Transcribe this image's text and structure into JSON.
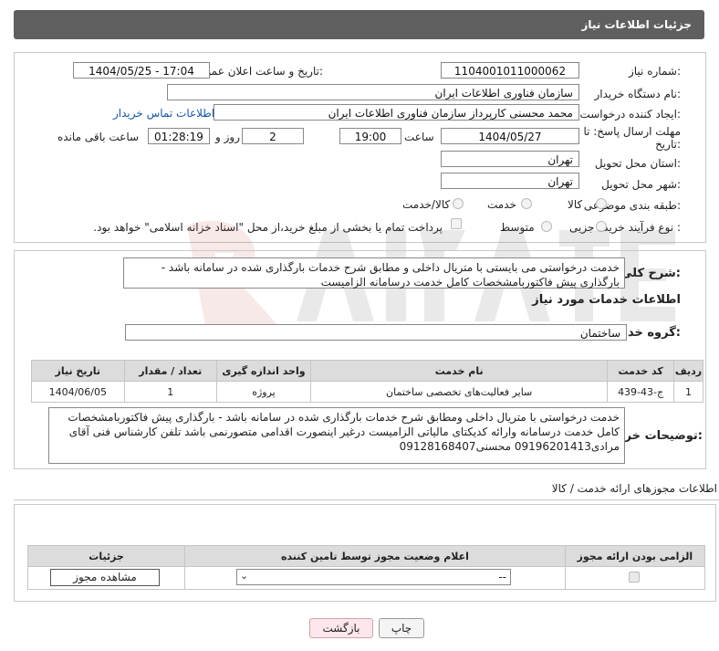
{
  "header": {
    "title": "جزئیات اطلاعات نیاز"
  },
  "form": {
    "need_number_label": "شماره نیاز:",
    "need_number": "1104001011000062",
    "announce_label": "تاریخ و ساعت اعلان عمومی:",
    "announce_value": "1404/05/25 - 17:04",
    "buyer_org_label": "نام دستگاه خریدار:",
    "buyer_org": "سازمان فناوری اطلاعات ایران",
    "requester_label": "ایجاد کننده درخواست:",
    "requester": "محمد محسنی کارپرداز سازمان فناوری اطلاعات ایران",
    "contact_link": "اطلاعات تماس خریدار",
    "deadline_label_1": "مهلت ارسال پاسخ: تا",
    "deadline_label_2": "تاریخ:",
    "deadline_date": "1404/05/27",
    "time_label": "ساعت",
    "deadline_time": "19:00",
    "days": "2",
    "days_label": "روز و",
    "remaining": "01:28:19",
    "remaining_label": "ساعت باقی مانده",
    "province_label": "استان محل تحویل:",
    "province": "تهران",
    "city_label": "شهر محل تحویل:",
    "city": "تهران",
    "category_label": "طبقه بندی موضوعی:",
    "category_options": [
      "کالا",
      "خدمت",
      "کالا/خدمت"
    ],
    "purchase_type_label": "نوع فرآیند خرید :",
    "purchase_type_options": [
      "جزیی",
      "متوسط"
    ],
    "treasury_note": "پرداخت تمام یا بخشی از مبلغ خرید،از محل \"اسناد خزانه اسلامی\" خواهد بود."
  },
  "summary": {
    "label": "شرح کلی نیاز:",
    "text": "خدمت درخواستی می بایستی با متریال داخلی و مطابق شرح خدمات بارگذاری شده در سامانه باشد - بارگذاری پیش فاکتوربامشخصات کامل خدمت درسامانه الزامیست"
  },
  "services": {
    "section_title": "اطلاعات خدمات مورد نیاز",
    "group_label": "گروه خدمت:",
    "group_value": "ساختمان",
    "columns": [
      "ردیف",
      "کد خدمت",
      "نام خدمت",
      "واحد اندازه گیری",
      "تعداد / مقدار",
      "تاریخ نیاز"
    ],
    "rows": [
      {
        "row": "1",
        "code": "ج-43-439",
        "name": "سایر فعالیت‌های تخصصی ساختمان",
        "unit": "پروژه",
        "qty": "1",
        "date": "1404/06/05"
      }
    ]
  },
  "buyer_notes": {
    "label": "توضیحات خریدار:",
    "text": "خدمت درخواستی با متریال داخلی ومطابق شرح خدمات بارگذاری شده در سامانه باشد - بارگذاری پیش فاکتوربامشخصات کامل خدمت درسامانه وارائه کدیکتای مالیاتی الزامیست درغیر اینصورت اقدامی متصورنمی باشد تلفن کارشناس فنی آقای مرادی09196201413 محسنی09128168407"
  },
  "permits": {
    "title": "اطلاعات مجوزهای ارائه خدمت / کالا",
    "columns": [
      "الزامی بودن ارائه مجوز",
      "اعلام وضعیت مجوز توسط تامین کننده",
      "جزئیات"
    ],
    "select_value": "--",
    "view_button": "مشاهده مجوز"
  },
  "footer": {
    "print": "چاپ",
    "back": "بازگشت"
  }
}
